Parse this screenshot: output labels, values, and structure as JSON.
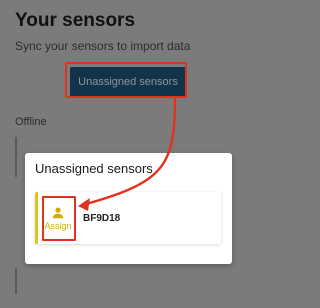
{
  "header": {
    "title": "Your sensors",
    "subtitle": "Sync your sensors to import data"
  },
  "toolbar": {
    "unassigned_button_label": "Unassigned sensors"
  },
  "sections": {
    "offline_label": "Offline"
  },
  "dialog": {
    "title": "Unassigned sensors",
    "sensors": [
      {
        "id": "BF9D18",
        "assign_label": "Assign"
      }
    ]
  },
  "colors": {
    "highlight": "#e0321e",
    "accent": "#e0c31f",
    "primary_button": "#12344a",
    "assign_text": "#d4ad00"
  },
  "icons": {
    "assign": "person-icon"
  }
}
